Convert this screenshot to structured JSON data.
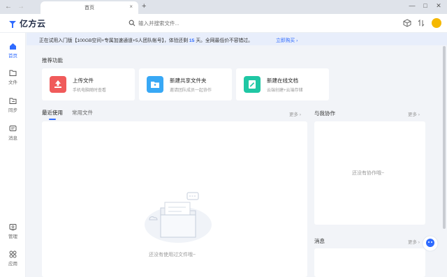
{
  "browser": {
    "tab_title": "首页",
    "tab_close": "×",
    "new_tab": "+",
    "back": "←",
    "forward": "→",
    "minimize": "—",
    "maximize": "□",
    "close": "✕"
  },
  "header": {
    "logo_text": "亿方云",
    "search_placeholder": "输入并搜索文件..."
  },
  "sidebar": {
    "items": [
      {
        "label": "首页",
        "icon": "home-icon"
      },
      {
        "label": "文件",
        "icon": "folder-icon"
      },
      {
        "label": "同步",
        "icon": "sync-folder-icon"
      },
      {
        "label": "消息",
        "icon": "message-icon"
      }
    ],
    "bottom_items": [
      {
        "label": "管理",
        "icon": "admin-icon"
      },
      {
        "label": "应用",
        "icon": "apps-icon"
      }
    ]
  },
  "banner": {
    "text_before": "正在试用入门版【100GB空间+专属加速通道+5人团队帐号】，体验还剩 ",
    "days": "15",
    "text_after": " 天。全网最低价不容错过。",
    "link": "立即购买"
  },
  "recommend": {
    "title": "推荐功能",
    "cards": [
      {
        "title": "上传文件",
        "desc": "手机电脑随时查看",
        "color": "#f05b5b"
      },
      {
        "title": "新建共享文件夹",
        "desc": "邀请团队成员一起协作",
        "color": "#38a8f5"
      },
      {
        "title": "新建在线文档",
        "desc": "云端创建+云端存储",
        "color": "#1fc7a4"
      }
    ]
  },
  "files": {
    "tabs": [
      "最近使用",
      "常用文件"
    ],
    "more": "更多 ›",
    "empty": "还没有使用过文件哦~"
  },
  "collab": {
    "title": "与我协作",
    "more": "更多 ›",
    "empty": "还没有协作哦~"
  },
  "messages": {
    "title": "消息",
    "more": "更多 ›"
  },
  "colors": {
    "accent": "#2f6bff",
    "banner_bg": "#e8eefb",
    "page_bg": "#f2f4f8"
  }
}
